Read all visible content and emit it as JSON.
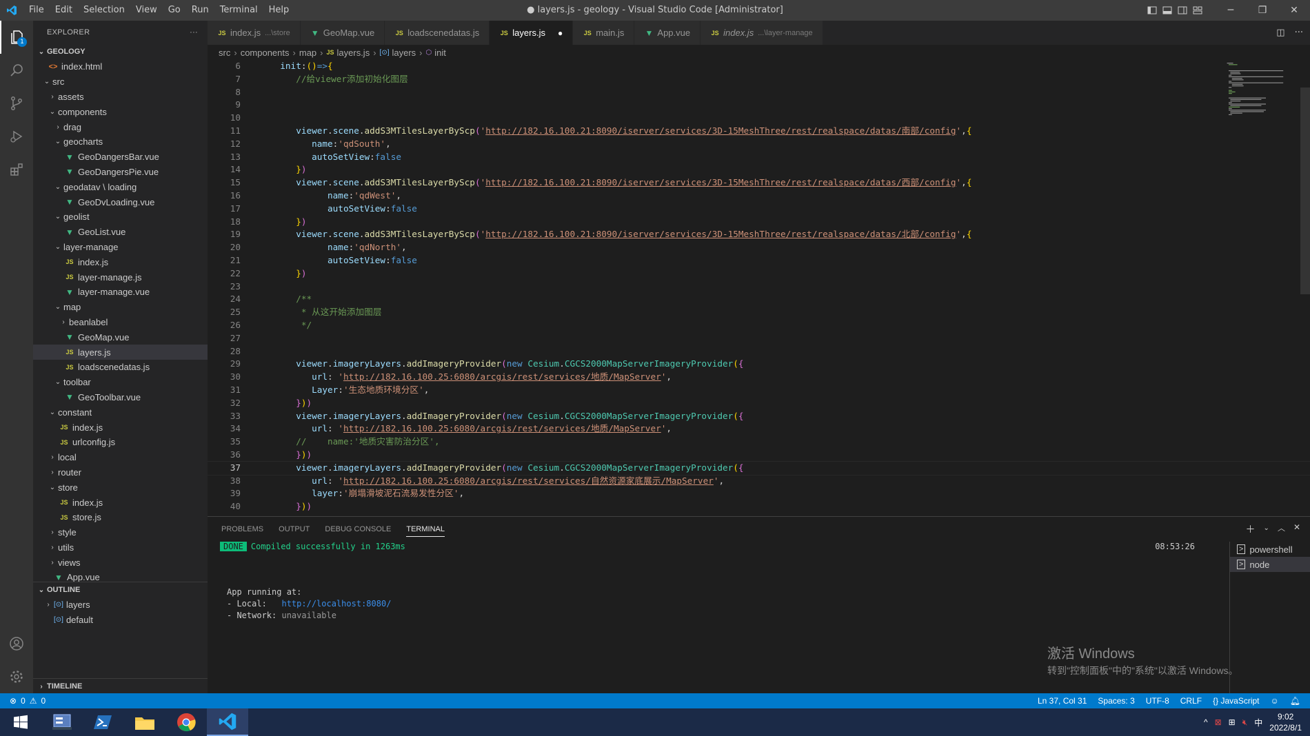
{
  "titlebar": {
    "menu": [
      "File",
      "Edit",
      "Selection",
      "View",
      "Go",
      "Run",
      "Terminal",
      "Help"
    ],
    "title": "● layers.js - geology - Visual Studio Code [Administrator]"
  },
  "explorer": {
    "header": "EXPLORER",
    "more": "···",
    "root": "GEOLOGY",
    "tree": [
      {
        "depth": 1,
        "type": "html",
        "label": "index.html"
      },
      {
        "depth": 1,
        "type": "folder-open",
        "label": "src"
      },
      {
        "depth": 2,
        "type": "folder",
        "label": "assets"
      },
      {
        "depth": 2,
        "type": "folder-open",
        "label": "components"
      },
      {
        "depth": 3,
        "type": "folder",
        "label": "drag"
      },
      {
        "depth": 3,
        "type": "folder-open",
        "label": "geocharts"
      },
      {
        "depth": 4,
        "type": "vue",
        "label": "GeoDangersBar.vue"
      },
      {
        "depth": 4,
        "type": "vue",
        "label": "GeoDangersPie.vue"
      },
      {
        "depth": 3,
        "type": "folder-open",
        "label": "geodatav \\ loading"
      },
      {
        "depth": 4,
        "type": "vue",
        "label": "GeoDvLoading.vue"
      },
      {
        "depth": 3,
        "type": "folder-open",
        "label": "geolist"
      },
      {
        "depth": 4,
        "type": "vue",
        "label": "GeoList.vue"
      },
      {
        "depth": 3,
        "type": "folder-open",
        "label": "layer-manage"
      },
      {
        "depth": 4,
        "type": "js",
        "label": "index.js"
      },
      {
        "depth": 4,
        "type": "js",
        "label": "layer-manage.js"
      },
      {
        "depth": 4,
        "type": "vue",
        "label": "layer-manage.vue"
      },
      {
        "depth": 3,
        "type": "folder-open",
        "label": "map"
      },
      {
        "depth": 4,
        "type": "folder",
        "label": "beanlabel"
      },
      {
        "depth": 4,
        "type": "vue",
        "label": "GeoMap.vue"
      },
      {
        "depth": 4,
        "type": "js",
        "label": "layers.js",
        "selected": true
      },
      {
        "depth": 4,
        "type": "js",
        "label": "loadscenedatas.js"
      },
      {
        "depth": 3,
        "type": "folder-open",
        "label": "toolbar"
      },
      {
        "depth": 4,
        "type": "vue",
        "label": "GeoToolbar.vue"
      },
      {
        "depth": 2,
        "type": "folder-open",
        "label": "constant"
      },
      {
        "depth": 3,
        "type": "js",
        "label": "index.js"
      },
      {
        "depth": 3,
        "type": "js",
        "label": "urlconfig.js"
      },
      {
        "depth": 2,
        "type": "folder",
        "label": "local"
      },
      {
        "depth": 2,
        "type": "folder",
        "label": "router"
      },
      {
        "depth": 2,
        "type": "folder-open",
        "label": "store"
      },
      {
        "depth": 3,
        "type": "js",
        "label": "index.js"
      },
      {
        "depth": 3,
        "type": "js",
        "label": "store.js"
      },
      {
        "depth": 2,
        "type": "folder",
        "label": "style"
      },
      {
        "depth": 2,
        "type": "folder",
        "label": "utils"
      },
      {
        "depth": 2,
        "type": "folder",
        "label": "views"
      },
      {
        "depth": 2,
        "type": "vue",
        "label": "App.vue"
      }
    ],
    "outline_header": "OUTLINE",
    "outline": [
      "layers",
      "default"
    ],
    "timeline_header": "TIMELINE"
  },
  "tabs": [
    {
      "icon": "JS",
      "name": "index.js",
      "desc": "...\\store",
      "active": false,
      "italic": false
    },
    {
      "icon": "V",
      "name": "GeoMap.vue",
      "desc": "",
      "active": false,
      "italic": false
    },
    {
      "icon": "JS",
      "name": "loadscenedatas.js",
      "desc": "",
      "active": false,
      "italic": false
    },
    {
      "icon": "JS",
      "name": "layers.js",
      "desc": "",
      "active": true,
      "italic": false,
      "dirty": true
    },
    {
      "icon": "JS",
      "name": "main.js",
      "desc": "",
      "active": false,
      "italic": false
    },
    {
      "icon": "V",
      "name": "App.vue",
      "desc": "",
      "active": false,
      "italic": false
    },
    {
      "icon": "JS",
      "name": "index.js",
      "desc": "...\\layer-manage",
      "active": false,
      "italic": true
    }
  ],
  "breadcrumb": {
    "parts": [
      "src",
      "components",
      "map",
      "layers.js",
      "layers",
      "init"
    ]
  },
  "editor": {
    "current_line": 37,
    "lines": [
      {
        "n": 6,
        "html": "  <span class='prop'>init</span>:<span class='pun2'>()</span><span class='kw'>=&gt;</span><span class='pun2'>{</span>"
      },
      {
        "n": 7,
        "html": "     <span class='cm'>//给viewer添加初始化图层</span>"
      },
      {
        "n": 8,
        "html": ""
      },
      {
        "n": 9,
        "html": ""
      },
      {
        "n": 10,
        "html": ""
      },
      {
        "n": 11,
        "html": "     <span class='prop'>viewer</span>.<span class='prop'>scene</span>.<span class='fn'>addS3MTilesLayerByScp</span><span class='pun'>(</span><span class='str'>'</span><span class='url'>http://182.16.100.21:8090/iserver/services/3D-15MeshThree/rest/realspace/datas/南部/config</span><span class='str'>'</span>,<span class='pun2'>{</span>"
      },
      {
        "n": 12,
        "html": "        <span class='prop'>name</span>:<span class='str'>'qdSouth'</span>,"
      },
      {
        "n": 13,
        "html": "        <span class='prop'>autoSetView</span>:<span class='kw'>false</span>"
      },
      {
        "n": 14,
        "html": "     <span class='pun2'>}</span><span class='pun'>)</span>"
      },
      {
        "n": 15,
        "html": "     <span class='prop'>viewer</span>.<span class='prop'>scene</span>.<span class='fn'>addS3MTilesLayerByScp</span><span class='pun'>(</span><span class='str'>'</span><span class='url'>http://182.16.100.21:8090/iserver/services/3D-15MeshThree/rest/realspace/datas/西部/config</span><span class='str'>'</span>,<span class='pun2'>{</span>"
      },
      {
        "n": 16,
        "html": "           <span class='prop'>name</span>:<span class='str'>'qdWest'</span>,"
      },
      {
        "n": 17,
        "html": "           <span class='prop'>autoSetView</span>:<span class='kw'>false</span>"
      },
      {
        "n": 18,
        "html": "     <span class='pun2'>}</span><span class='pun'>)</span>"
      },
      {
        "n": 19,
        "html": "     <span class='prop'>viewer</span>.<span class='prop'>scene</span>.<span class='fn'>addS3MTilesLayerByScp</span><span class='pun'>(</span><span class='str'>'</span><span class='url'>http://182.16.100.21:8090/iserver/services/3D-15MeshThree/rest/realspace/datas/北部/config</span><span class='str'>'</span>,<span class='pun2'>{</span>"
      },
      {
        "n": 20,
        "html": "           <span class='prop'>name</span>:<span class='str'>'qdNorth'</span>,"
      },
      {
        "n": 21,
        "html": "           <span class='prop'>autoSetView</span>:<span class='kw'>false</span>"
      },
      {
        "n": 22,
        "html": "     <span class='pun2'>}</span><span class='pun'>)</span>"
      },
      {
        "n": 23,
        "html": ""
      },
      {
        "n": 24,
        "html": "     <span class='cm'>/**</span>"
      },
      {
        "n": 25,
        "html": "     <span class='cm'> * 从这开始添加图层</span>"
      },
      {
        "n": 26,
        "html": "     <span class='cm'> */</span>"
      },
      {
        "n": 27,
        "html": ""
      },
      {
        "n": 28,
        "html": ""
      },
      {
        "n": 29,
        "html": "     <span class='prop'>viewer</span>.<span class='prop'>imageryLayers</span>.<span class='fn'>addImageryProvider</span><span class='pun'>(</span><span class='kw'>new</span> <span class='cls'>Cesium</span>.<span class='cls'>CGCS2000MapServerImageryProvider</span><span class='pun2'>(</span><span class='pun'>{</span>"
      },
      {
        "n": 30,
        "html": "        <span class='prop'>url</span>: <span class='str'>'</span><span class='url'>http://182.16.100.25:6080/arcgis/rest/services/地质/MapServer</span><span class='str'>'</span>,"
      },
      {
        "n": 31,
        "html": "        <span class='prop'>Layer</span>:<span class='str'>'生态地质环境分区'</span>,"
      },
      {
        "n": 32,
        "html": "     <span class='pun'>}</span><span class='pun2'>)</span><span class='pun'>)</span>"
      },
      {
        "n": 33,
        "html": "     <span class='prop'>viewer</span>.<span class='prop'>imageryLayers</span>.<span class='fn'>addImageryProvider</span><span class='pun'>(</span><span class='kw'>new</span> <span class='cls'>Cesium</span>.<span class='cls'>CGCS2000MapServerImageryProvider</span><span class='pun2'>(</span><span class='pun'>{</span>"
      },
      {
        "n": 34,
        "html": "        <span class='prop'>url</span>: <span class='str'>'</span><span class='url'>http://182.16.100.25:6080/arcgis/rest/services/地质/MapServer</span><span class='str'>'</span>,"
      },
      {
        "n": 35,
        "html": "     <span class='cm'>//    name:'地质灾害防治分区',</span>"
      },
      {
        "n": 36,
        "html": "     <span class='pun'>}</span><span class='pun2'>)</span><span class='pun'>)</span>"
      },
      {
        "n": 37,
        "html": "     <span class='prop'>viewer</span>.<span class='prop'>imageryLayers</span>.<span class='fn'>addImageryProvider</span><span class='pun'>(</span><span class='kw'>new</span> <span class='cls'>Cesium</span>.<span class='cls'>CGCS2000MapServerImageryProvider</span><span class='pun2'>(</span><span class='pun'>{</span>"
      },
      {
        "n": 38,
        "html": "        <span class='prop'>url</span>: <span class='str'>'</span><span class='url'>http://182.16.100.25:6080/arcgis/rest/services/自然资源家底展示/MapServer</span><span class='str'>'</span>,"
      },
      {
        "n": 39,
        "html": "        <span class='prop'>layer</span>:<span class='str'>'崩塌滑坡泥石流易发性分区'</span>,"
      },
      {
        "n": 40,
        "html": "     <span class='pun'>}</span><span class='pun2'>)</span><span class='pun'>)</span>"
      },
      {
        "n": 41,
        "html": ""
      }
    ]
  },
  "panel": {
    "tabs": [
      "PROBLEMS",
      "OUTPUT",
      "DEBUG CONSOLE",
      "TERMINAL"
    ],
    "active_tab": "TERMINAL",
    "terminal": {
      "done": "DONE",
      "compiled": "Compiled successfully in 1263ms",
      "time": "08:53:26",
      "running": "App running at:",
      "local_label": "- Local:   ",
      "local_url": "http://localhost:8080/",
      "network_label": "- Network: ",
      "network_value": "unavailable"
    },
    "terminals": [
      "powershell",
      "node"
    ],
    "watermark_title": "激活 Windows",
    "watermark_sub": "转到\"控制面板\"中的\"系统\"以激活 Windows。"
  },
  "statusbar": {
    "errors": "0",
    "warnings": "0",
    "position": "Ln 37, Col 31",
    "spaces": "Spaces: 3",
    "encoding": "UTF-8",
    "eol": "CRLF",
    "language": "JavaScript"
  },
  "taskbar": {
    "time": "9:02",
    "date": "2022/8/1",
    "ime": "中"
  },
  "colors": {
    "accent": "#007acc",
    "background": "#1e1e1e"
  }
}
